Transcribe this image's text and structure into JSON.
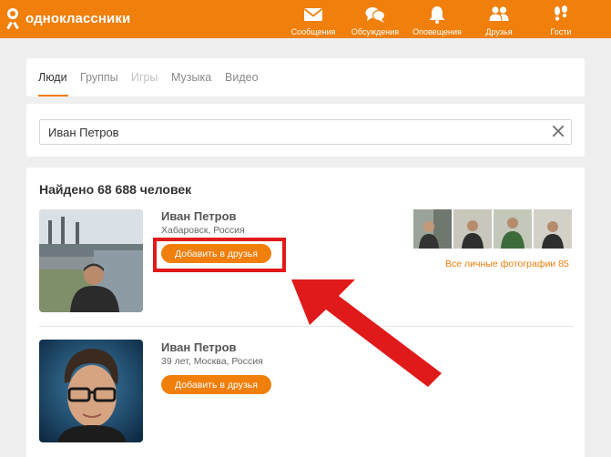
{
  "brand": {
    "name": "одноклассники"
  },
  "topnav": [
    {
      "label": "Сообщения",
      "icon": "envelope-icon"
    },
    {
      "label": "Обсуждения",
      "icon": "chat-bubbles-icon"
    },
    {
      "label": "Оповещения",
      "icon": "bell-icon"
    },
    {
      "label": "Друзья",
      "icon": "people-icon"
    },
    {
      "label": "Гости",
      "icon": "footprints-icon"
    }
  ],
  "tabs": [
    {
      "label": "Люди",
      "state": "active"
    },
    {
      "label": "Группы",
      "state": "normal"
    },
    {
      "label": "Игры",
      "state": "disabled"
    },
    {
      "label": "Музыка",
      "state": "normal"
    },
    {
      "label": "Видео",
      "state": "normal"
    }
  ],
  "search": {
    "value": "Иван Петров"
  },
  "results": {
    "title": "Найдено 68 688 человек",
    "items": [
      {
        "name": "Иван Петров",
        "info": "Хабаровск, Россия",
        "add_label": "Добавить в друзья",
        "all_photos_label": "Все личные фотографии 85"
      },
      {
        "name": "Иван Петров",
        "info": "39 лет, Москва, Россия",
        "add_label": "Добавить в друзья"
      }
    ]
  },
  "colors": {
    "accent": "#f07f0c",
    "annotation": "#e01a1a"
  }
}
